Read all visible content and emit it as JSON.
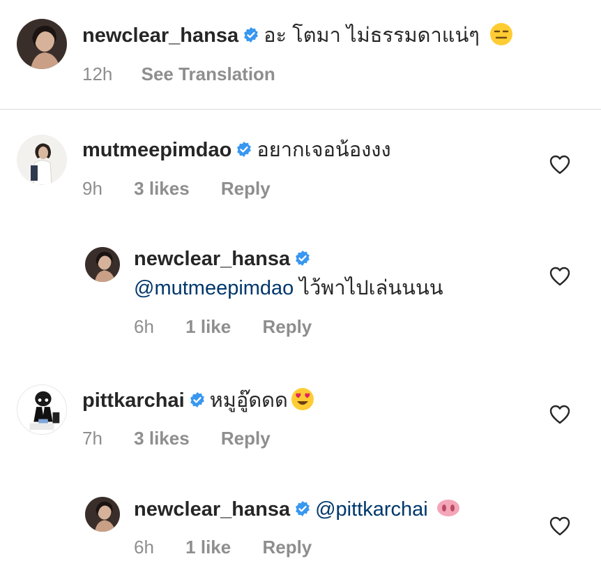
{
  "caption": {
    "username": "newclear_hansa",
    "text": "อะ โตมา ไม่ธรรมดาแน่ๆ",
    "emoji": "expressionless-face",
    "time": "12h",
    "translate_label": "See Translation"
  },
  "comments": [
    {
      "username": "mutmeepimdao",
      "text": "อยากเจอน้องงง",
      "time": "9h",
      "likes": "3 likes",
      "reply_label": "Reply"
    },
    {
      "username": "newclear_hansa",
      "mention": "@mutmeepimdao",
      "text": "ไว้พาไปเล่นนนน",
      "time": "6h",
      "likes": "1 like",
      "reply_label": "Reply"
    },
    {
      "username": "pittkarchai",
      "text": "หมูอู๊ดดด",
      "emoji": "heart-eyes-face",
      "time": "7h",
      "likes": "3 likes",
      "reply_label": "Reply"
    },
    {
      "username": "newclear_hansa",
      "mention": "@pittkarchai",
      "emoji": "pig-nose",
      "time": "6h",
      "likes": "1 like",
      "reply_label": "Reply"
    }
  ],
  "colors": {
    "text": "#262626",
    "secondary": "#8e8e8e",
    "mention": "#00376b",
    "verified": "#3897f0",
    "divider": "#dbdbdb"
  },
  "icons": {
    "verified": "verified-badge-icon",
    "like": "heart-outline-icon"
  }
}
